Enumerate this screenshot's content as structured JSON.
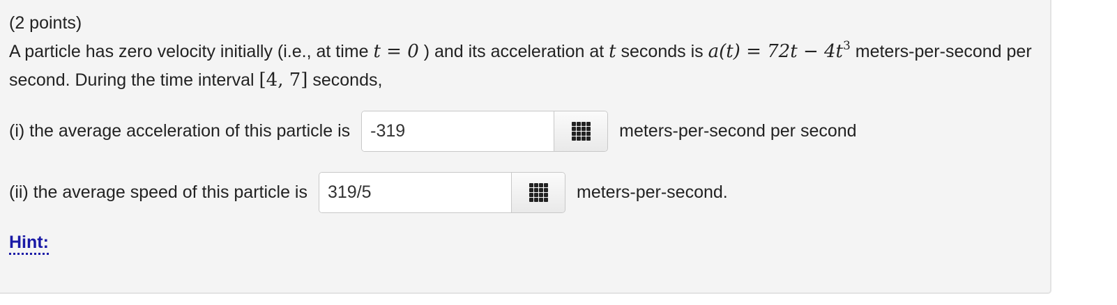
{
  "points": "(2 points)",
  "problem": {
    "text_1": "A particle has zero velocity initially (i.e., at time ",
    "math_t0": "t = 0",
    "text_2": " ) and its acceleration at ",
    "math_t": "t",
    "text_3": " seconds is ",
    "math_a": "a(t) = 72t − 4t",
    "math_exp": "3",
    "text_4": " meters-per-second per second. During the time interval ",
    "math_interval": "[4, 7]",
    "text_5": " seconds,"
  },
  "part_i": {
    "label": "(i) the average acceleration of this particle is",
    "value": "-319",
    "unit": "meters-per-second per second"
  },
  "part_ii": {
    "label": "(ii) the average speed of this particle is",
    "value": "319/5",
    "unit": "meters-per-second."
  },
  "hint": "Hint:",
  "icons": {
    "keypad": "keypad-grid-icon"
  }
}
